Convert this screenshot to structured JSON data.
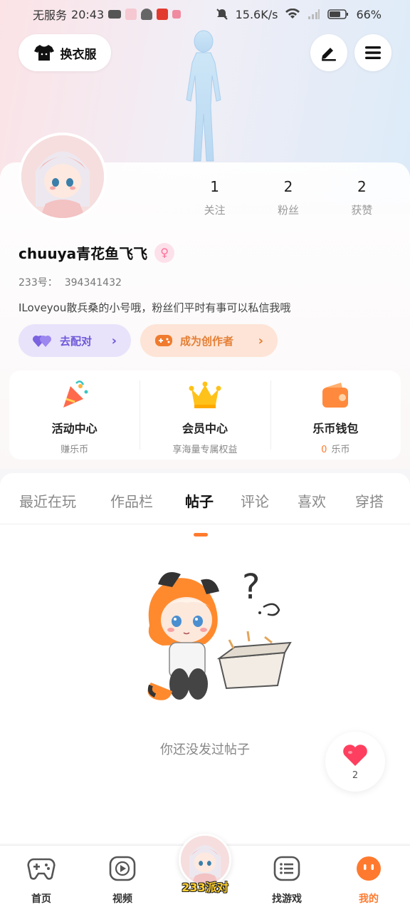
{
  "status_bar": {
    "carrier": "无服务",
    "time": "20:43",
    "speed": "15.6K/s",
    "battery": "66%"
  },
  "header": {
    "dress_label": "换衣服",
    "icons": [
      "shirt-icon",
      "pen-icon",
      "menu-icon"
    ]
  },
  "profile": {
    "stats": [
      {
        "value": "1",
        "label": "关注"
      },
      {
        "value": "2",
        "label": "粉丝"
      },
      {
        "value": "2",
        "label": "获赞"
      }
    ],
    "username": "chuuya青花鱼飞飞",
    "gender_symbol": "♀",
    "uid_label": "233号：",
    "uid_value": "394341432",
    "bio": "ILoveyou散兵桑的小号哦，粉丝们平时有事可以私信我哦"
  },
  "actions": {
    "match_label": "去配对",
    "creator_label": "成为创作者"
  },
  "features": [
    {
      "title": "活动中心",
      "sub": "赚乐币",
      "icon": "party-popper-icon"
    },
    {
      "title": "会员中心",
      "sub": "享海量专属权益",
      "icon": "crown-icon"
    },
    {
      "title": "乐币钱包",
      "accent": "0",
      "sub": "乐币",
      "icon": "wallet-icon"
    }
  ],
  "tabs": {
    "items": [
      "最近在玩",
      "作品栏",
      "帖子",
      "评论",
      "喜欢",
      "穿搭"
    ],
    "active_index": 2
  },
  "empty_state": {
    "text": "你还没发过帖子"
  },
  "like_bubble": {
    "count": "2"
  },
  "bottom_nav": {
    "items": [
      {
        "label": "首页",
        "icon": "gamepad-icon"
      },
      {
        "label": "视频",
        "icon": "play-icon"
      },
      {
        "label": "找游戏",
        "icon": "list-icon"
      },
      {
        "label": "我的",
        "icon": "smile-face-icon"
      }
    ],
    "center_brand": "233派对",
    "active_label": "我的"
  },
  "colors": {
    "accent_orange": "#ff7a2e",
    "match_purple": "#6f58d9",
    "creator_orange": "#e57e34",
    "gender_pink": "#ff6d99"
  }
}
